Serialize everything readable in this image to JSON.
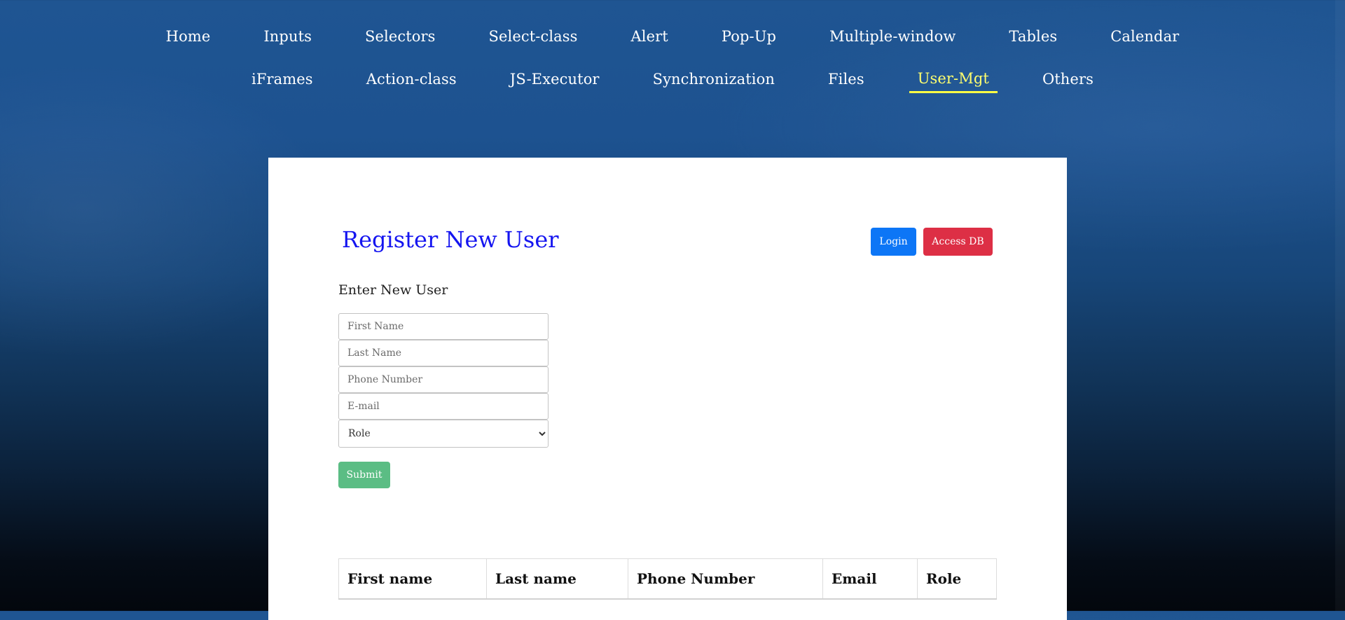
{
  "nav": {
    "row1": [
      "Home",
      "Inputs",
      "Selectors",
      "Select-class",
      "Alert",
      "Pop-Up",
      "Multiple-window",
      "Tables",
      "Calendar"
    ],
    "row2": [
      "iFrames",
      "Action-class",
      "JS-Executor",
      "Synchronization",
      "Files",
      "User-Mgt",
      "Others"
    ],
    "active": "User-Mgt"
  },
  "main": {
    "title": "Register New User",
    "login_label": "Login",
    "access_db_label": "Access DB",
    "subheading": "Enter New User"
  },
  "form": {
    "first_name_placeholder": "First Name",
    "last_name_placeholder": "Last Name",
    "phone_placeholder": "Phone Number",
    "email_placeholder": "E-mail",
    "role_selected": "Role",
    "submit_label": "Submit"
  },
  "table": {
    "headers": [
      "First name",
      "Last name",
      "Phone Number",
      "Email",
      "Role"
    ]
  },
  "colors": {
    "title": "#1515f0",
    "active_nav": "#ffff6e",
    "login_button": "#0d76f6",
    "access_db_button": "#dd2f45",
    "submit_button": "#5bbd84"
  }
}
